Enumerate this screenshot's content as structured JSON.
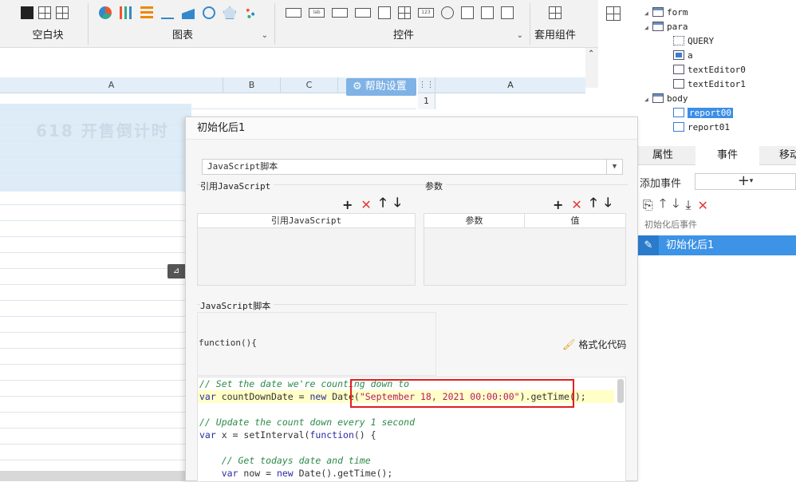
{
  "ribbon": {
    "groups": [
      {
        "label": "空白块"
      },
      {
        "label": "图表"
      },
      {
        "label": "控件"
      },
      {
        "label": "套用组件"
      }
    ],
    "control_icon_labels": [
      "lab",
      "123"
    ]
  },
  "sheet": {
    "col_headers": [
      "A",
      "B",
      "C"
    ],
    "right_col_header": "A",
    "right_row_number": "1",
    "help_button": "帮助设置",
    "banner_ghost_text": "618 开售倒计时"
  },
  "tree": {
    "nodes": [
      {
        "label": "form",
        "level": 0,
        "expanded": true
      },
      {
        "label": "para",
        "level": 1,
        "expanded": true
      },
      {
        "label": "QUERY",
        "level": 2
      },
      {
        "label": "a",
        "level": 2
      },
      {
        "label": "textEditor0",
        "level": 2
      },
      {
        "label": "textEditor1",
        "level": 2
      },
      {
        "label": "body",
        "level": 1,
        "expanded": true
      },
      {
        "label": "report00",
        "level": 2,
        "selected": true
      },
      {
        "label": "report01",
        "level": 2
      }
    ]
  },
  "props": {
    "tabs": [
      "属性",
      "事件",
      "移动"
    ],
    "active_tab": "事件",
    "add_event_label": "添加事件",
    "add_event_button": "+",
    "event_group": "初始化后事件",
    "event_item": "初始化后1"
  },
  "dialog": {
    "title": "初始化后1",
    "language": "JavaScript脚本",
    "ref_js_label": "引用JavaScript",
    "params_label": "参数",
    "ref_js_col": "引用JavaScript",
    "param_col": "参数",
    "value_col": "值",
    "script_label": "JavaScript脚本",
    "function_header": "function(){",
    "format_button": "格式化代码",
    "code_lines": [
      {
        "type": "comment",
        "text": "// Set the date we're counting down to"
      },
      {
        "type": "mixed",
        "kw1": "var",
        "t1": " countDownDate = ",
        "kw2": "new",
        "t2": " Date(",
        "str": "\"September 18, 2021 00:00:00\"",
        "t3": ").getTime();"
      },
      {
        "type": "blank",
        "text": ""
      },
      {
        "type": "comment",
        "text": "// Update the count down every 1 second"
      },
      {
        "type": "mixed2",
        "kw1": "var",
        "t1": " x = setInterval(",
        "kw2": "function",
        "t2": "() {"
      },
      {
        "type": "blank",
        "text": ""
      },
      {
        "type": "comment",
        "text": "    // Get todays date and time"
      },
      {
        "type": "mixed3",
        "kw1": "    var",
        "t1": " now = ",
        "kw2": "new",
        "t2": " Date().getTime();"
      }
    ]
  },
  "colors": {
    "accent": "#3d93e6",
    "delete": "#e53935",
    "highlight_box": "#e02020",
    "code_comment": "#2d8a4a",
    "code_keyword": "#2a2aa8",
    "code_string": "#b5186b"
  }
}
